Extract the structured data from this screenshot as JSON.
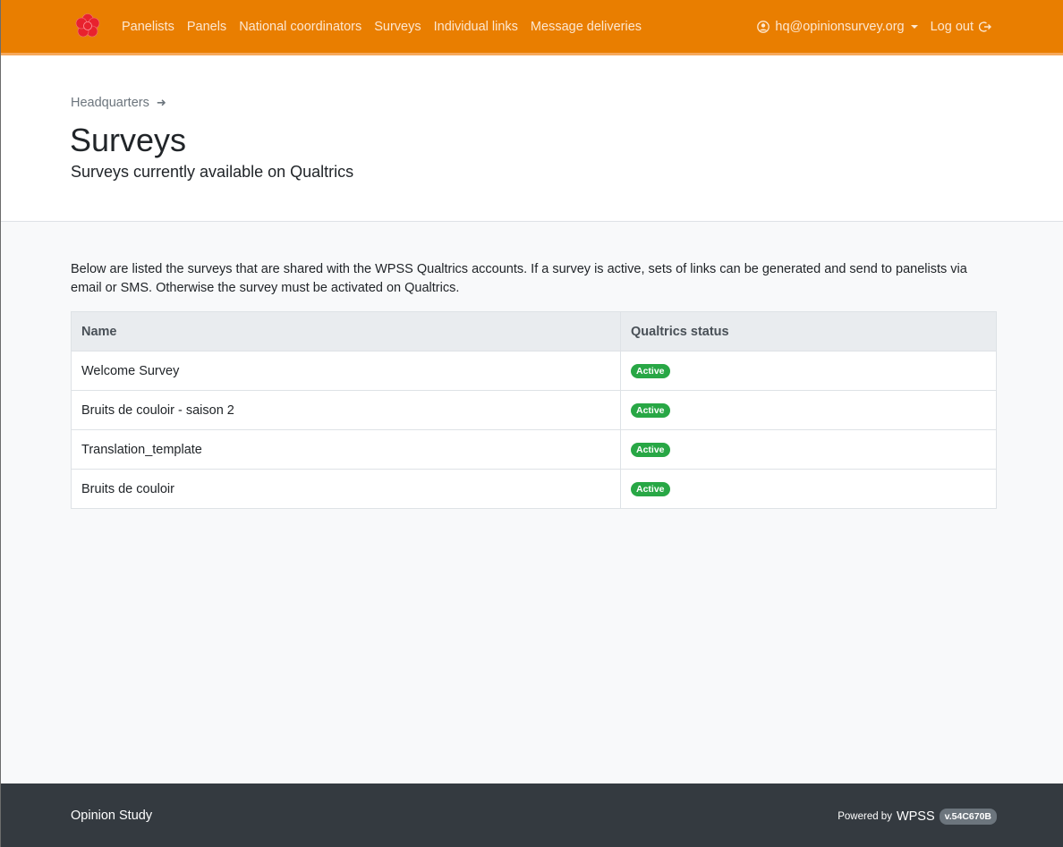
{
  "nav": {
    "links": [
      {
        "label": "Panelists"
      },
      {
        "label": "Panels"
      },
      {
        "label": "National coordinators"
      },
      {
        "label": "Surveys"
      },
      {
        "label": "Individual links"
      },
      {
        "label": "Message deliveries"
      }
    ],
    "user_email": "hq@opinionsurvey.org",
    "logout_label": "Log out",
    "brand_color": "#e97e00"
  },
  "header": {
    "breadcrumb": "Headquarters",
    "title": "Surveys",
    "subtitle": "Surveys currently available on Qualtrics"
  },
  "main": {
    "intro": "Below are listed the surveys that are shared with the WPSS Qualtrics accounts. If a survey is active, sets of links can be generated and send to panelists via email or SMS. Otherwise the survey must be activated on Qualtrics.",
    "table": {
      "columns": [
        "Name",
        "Qualtrics status"
      ],
      "rows": [
        {
          "name": "Welcome Survey",
          "status": "Active"
        },
        {
          "name": "Bruits de couloir - saison 2",
          "status": "Active"
        },
        {
          "name": "Translation_template",
          "status": "Active"
        },
        {
          "name": "Bruits de couloir",
          "status": "Active"
        }
      ]
    },
    "status_color": "#28a745"
  },
  "footer": {
    "brand": "Opinion Study",
    "powered_by": "Powered by",
    "product": "WPSS",
    "version": "v.54C670B"
  }
}
